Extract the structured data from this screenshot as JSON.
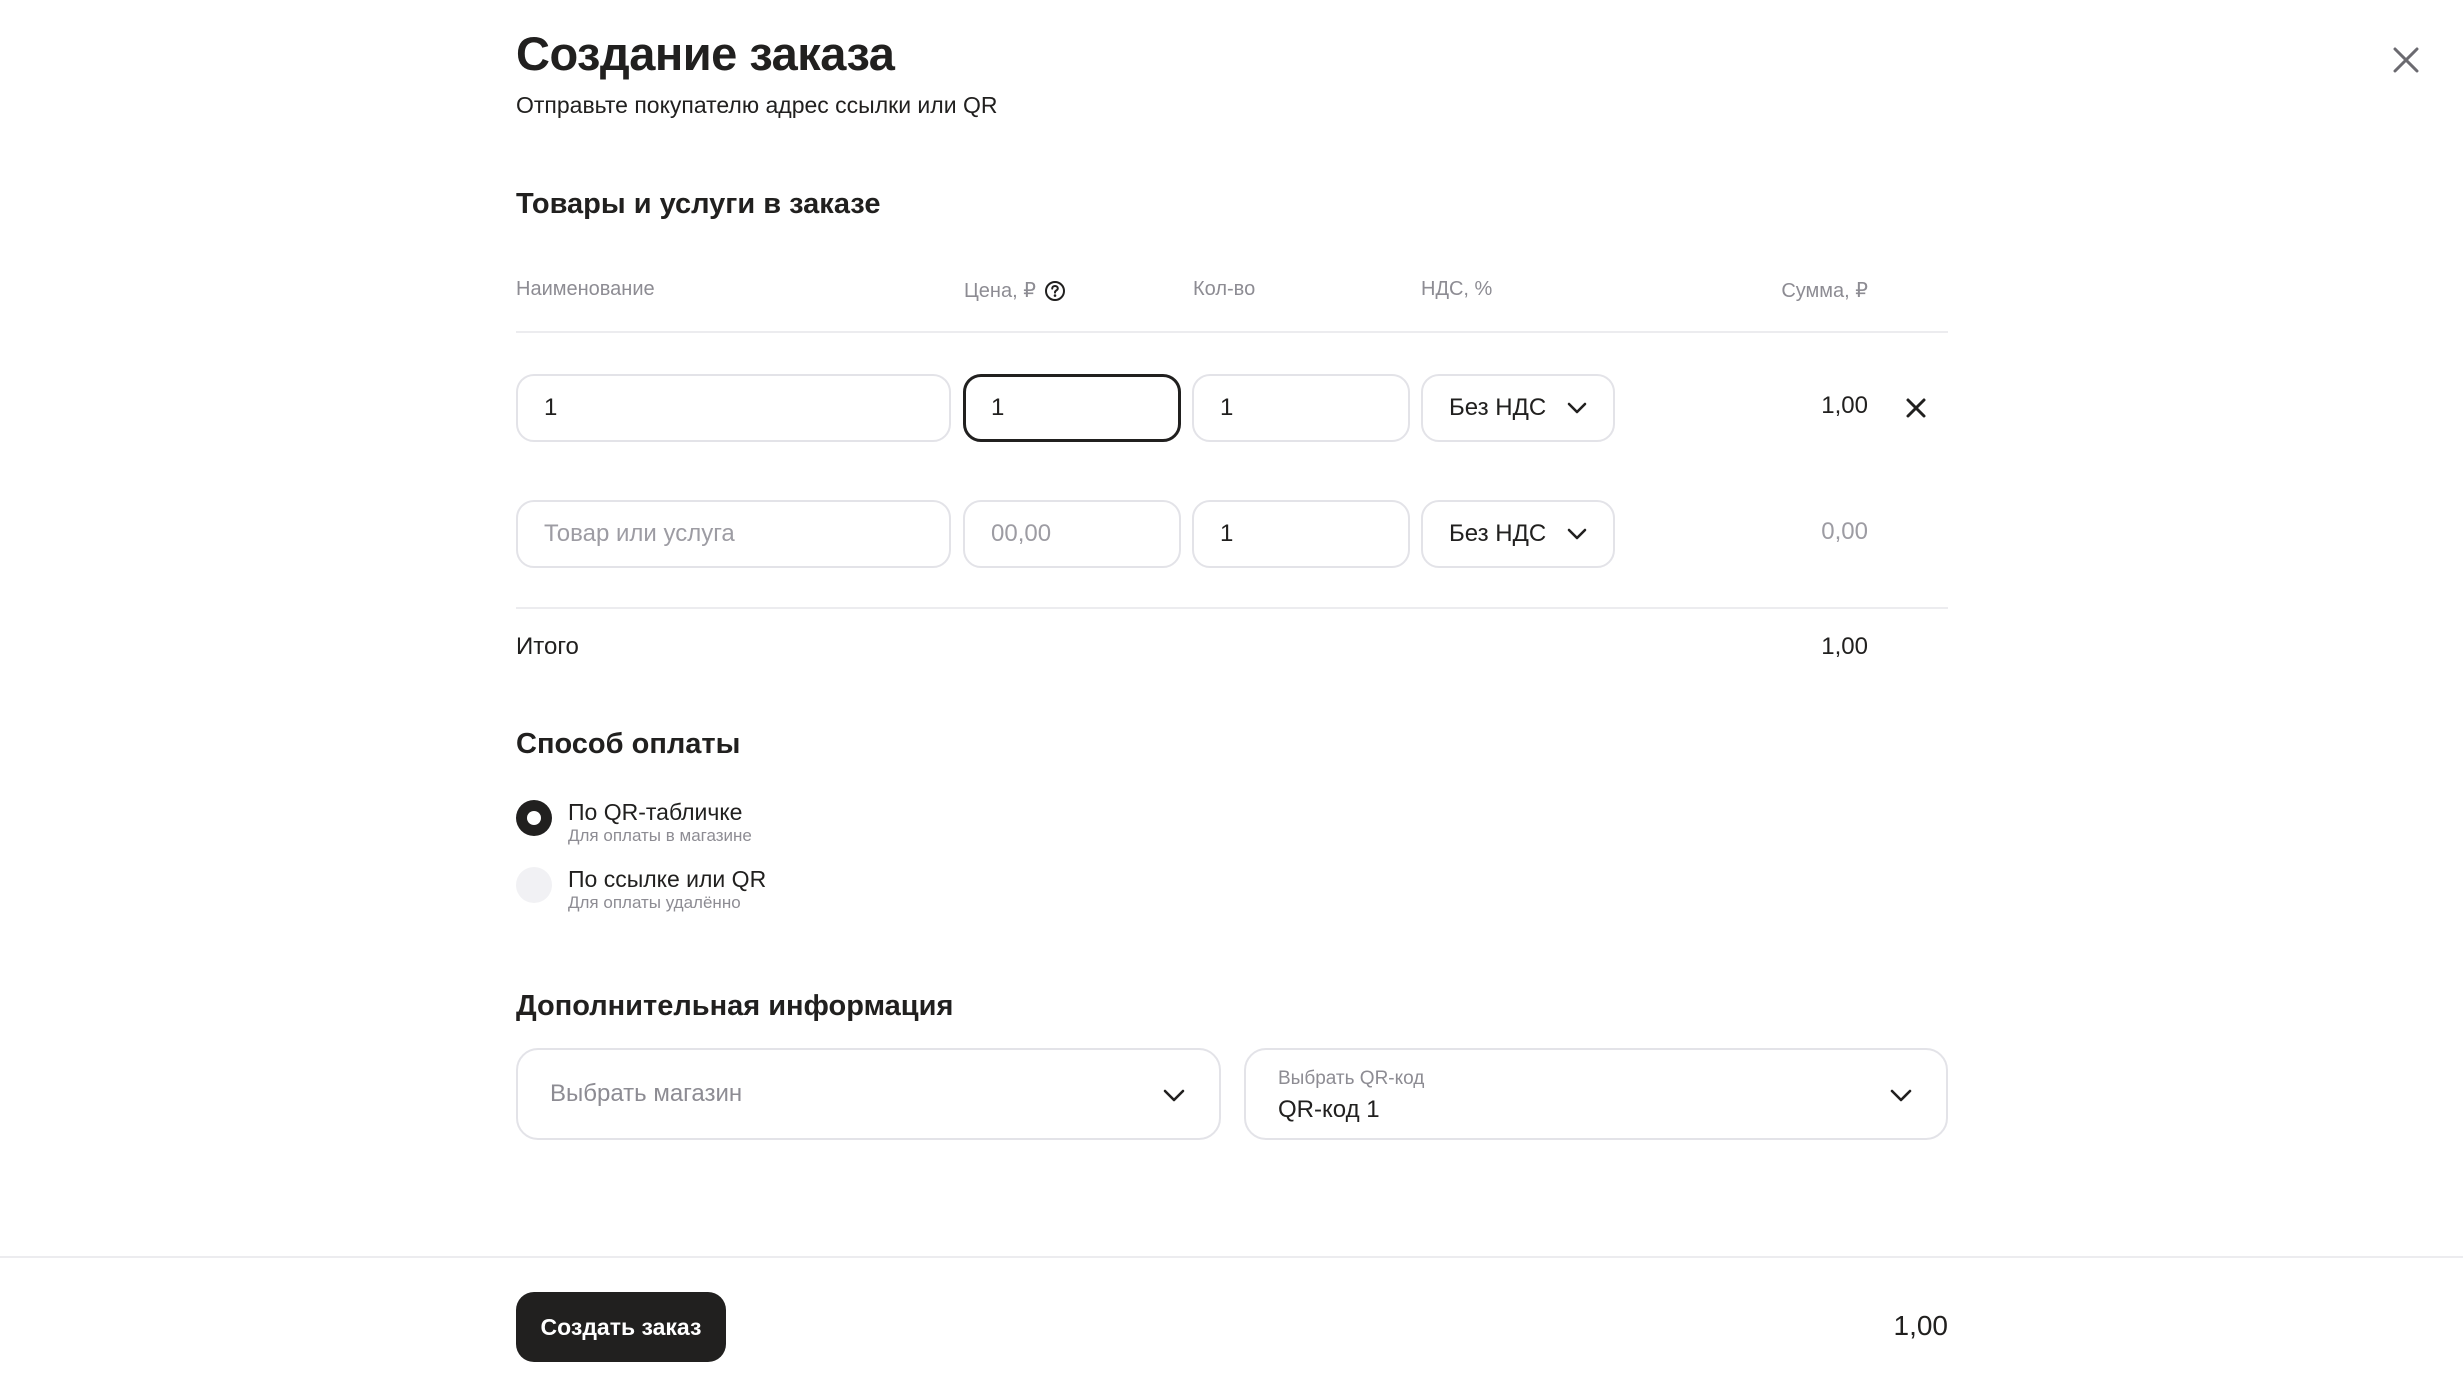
{
  "header": {
    "title": "Создание заказа",
    "subtitle": "Отправьте покупателю адрес ссылки или QR"
  },
  "items_section": {
    "title": "Товары и услуги в заказе",
    "columns": {
      "name": "Наименование",
      "price": "Цена, ₽",
      "qty": "Кол-во",
      "vat": "НДС, %",
      "sum": "Сумма, ₽"
    },
    "rows": [
      {
        "name": "1",
        "price": "1",
        "qty": "1",
        "vat": "Без НДС",
        "sum": "1,00"
      },
      {
        "name_placeholder": "Товар или услуга",
        "price_placeholder": "00,00",
        "qty": "1",
        "vat": "Без НДС",
        "sum": "0,00"
      }
    ],
    "total_label": "Итого",
    "total_value": "1,00"
  },
  "payment": {
    "title": "Способ оплаты",
    "options": [
      {
        "label": "По QR-табличке",
        "sub": "Для оплаты в магазине",
        "selected": true
      },
      {
        "label": "По ссылке или QR",
        "sub": "Для оплаты удалённо",
        "selected": false
      }
    ]
  },
  "extra": {
    "title": "Дополнительная информация",
    "store_placeholder": "Выбрать магазин",
    "qr_label": "Выбрать QR-код",
    "qr_value": "QR-код 1"
  },
  "footer": {
    "create_label": "Создать заказ",
    "total": "1,00"
  },
  "icons": {
    "close": "close-icon",
    "help": "help-circle-icon",
    "chevron": "chevron-down-icon",
    "remove": "remove-row-icon"
  },
  "colors": {
    "text": "#21201f",
    "muted": "#8d8c93",
    "border": "#e3e3e8",
    "button_bg": "#21201f"
  }
}
